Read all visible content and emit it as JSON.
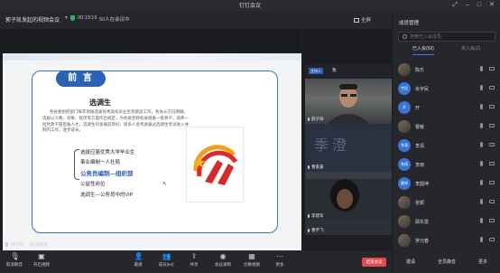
{
  "window": {
    "title": "钉钉会议",
    "controls": [
      "restore",
      "minimize",
      "maximize",
      "close"
    ]
  },
  "meeting": {
    "title": "郭子凯发起的视频会议",
    "timer": "00:13:19",
    "online": "50人在会议中",
    "fullscreen": "全屏"
  },
  "slide": {
    "heading": "前 言",
    "subtitle": "选调生",
    "paragraph": "各省委组织部门每年划拨选拔优秀高校毕业生到基层工作，各省从方向明确、选拔以人数、对象、程序等方面作出规定，为各级党政机关储备一批骨干，培养一批党政干部后备人才。选调生的发展前景好，很多人会考虑通过选调生考试进入体制内工作，逐步成长。",
    "list": [
      {
        "text": "选拔应届优秀大学毕业生",
        "style": "normal"
      },
      {
        "text": "事业编制一人社局",
        "style": "normal"
      },
      {
        "text": "公务员编制—组织部",
        "style": "big"
      },
      {
        "text": "公益性岗位",
        "style": "normal"
      },
      {
        "text": "选调生—公务员中的VIP",
        "style": "normal"
      }
    ],
    "logo_name": "jiangyi-logo"
  },
  "speaker": {
    "name": "薛子阳",
    "second_label": "取消静音"
  },
  "videos": {
    "host_badge": "主持人",
    "host_name": "我",
    "tiles": [
      {
        "name": "薛子阳"
      },
      {
        "name": "曹家豪",
        "watermark": "季澄"
      },
      {
        "name": "李建军"
      },
      {
        "name": "曹宇飞"
      }
    ]
  },
  "members": {
    "title": "成员管理",
    "search_placeholder": "搜索已入会成员",
    "tab_joined": "已入会(50)",
    "tab_not_joined": "未入会(2)",
    "list": [
      {
        "name": "陈乐",
        "avatar": "photo"
      },
      {
        "name": "余宇民",
        "avatar": "text",
        "initials": "宇民"
      },
      {
        "name": "开",
        "avatar": "text",
        "initials": "开"
      },
      {
        "name": "曹敏",
        "avatar": "photo"
      },
      {
        "name": "李清",
        "avatar": "text",
        "initials": "李清"
      },
      {
        "name": "李雨",
        "avatar": "text",
        "initials": "李雨"
      },
      {
        "name": "李圆坤",
        "avatar": "text",
        "initials": "圆坤"
      },
      {
        "name": "张颖",
        "avatar": "photo"
      },
      {
        "name": "顾东雷",
        "avatar": "photo"
      },
      {
        "name": "罗元春",
        "avatar": "photo"
      }
    ],
    "footer": [
      "邀请",
      "全员静音",
      "更多"
    ]
  },
  "toolbar": {
    "items": [
      {
        "label": "取消静音",
        "icon": "mic-icon"
      },
      {
        "label": "开启视频",
        "icon": "camera-icon"
      },
      {
        "label": "邀请",
        "icon": "invite-icon"
      },
      {
        "label": "成员(54)",
        "icon": "members-icon"
      },
      {
        "label": "共享",
        "icon": "share-icon"
      },
      {
        "label": "会议录制",
        "icon": "record-icon"
      },
      {
        "label": "切换视图",
        "icon": "layout-icon"
      },
      {
        "label": "更多",
        "icon": "more-icon"
      }
    ],
    "end": "结束会议"
  },
  "colors": {
    "accent": "#3a7bf0",
    "slide_blue": "#2d61b4",
    "end_red": "#e5484d",
    "shield_green": "#2db567"
  }
}
